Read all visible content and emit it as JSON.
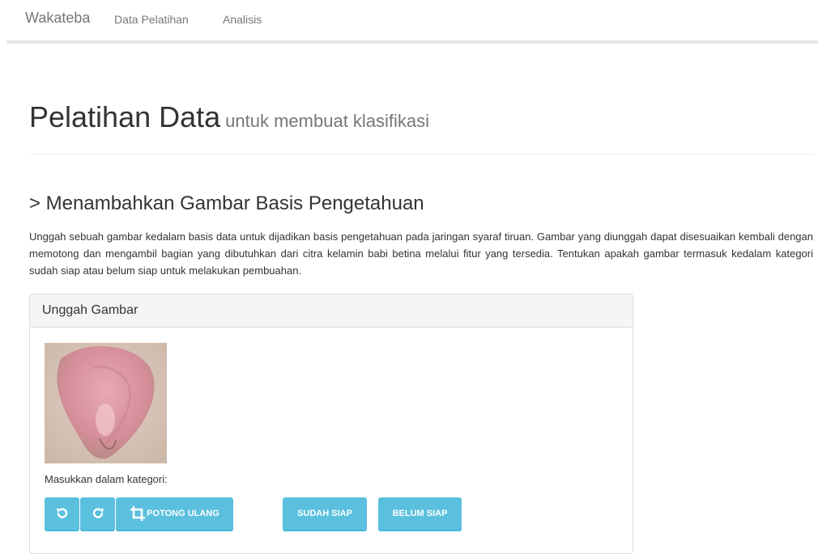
{
  "navbar": {
    "brand": "Wakateba",
    "links": [
      "Data Pelatihan",
      "Analisis"
    ]
  },
  "header": {
    "title": "Pelatihan Data",
    "subtitle": "untuk membuat klasifikasi"
  },
  "section": {
    "title": "> Menambahkan Gambar Basis Pengetahuan",
    "description": "Unggah sebuah gambar kedalam basis data untuk dijadikan basis pengetahuan pada jaringan syaraf tiruan. Gambar yang diunggah dapat disesuaikan kembali dengan memotong dan mengambil bagian yang dibutuhkan dari citra kelamin babi betina melalui fitur yang tersedia. Tentukan apakah gambar termasuk kedalam kategori sudah siap atau belum siap untuk melakukan pembuahan."
  },
  "panel": {
    "heading": "Unggah Gambar",
    "category_label": "Masukkan dalam kategori:",
    "buttons": {
      "rotate_left_icon": "rotate-left-icon",
      "rotate_right_icon": "rotate-right-icon",
      "crop_icon": "crop-icon",
      "crop": "POTONG ULANG",
      "ready": "SUDAH SIAP",
      "not_ready": "BELUM SIAP"
    }
  },
  "colors": {
    "button": "#5bc0de",
    "text": "#333333",
    "muted": "#777777"
  }
}
